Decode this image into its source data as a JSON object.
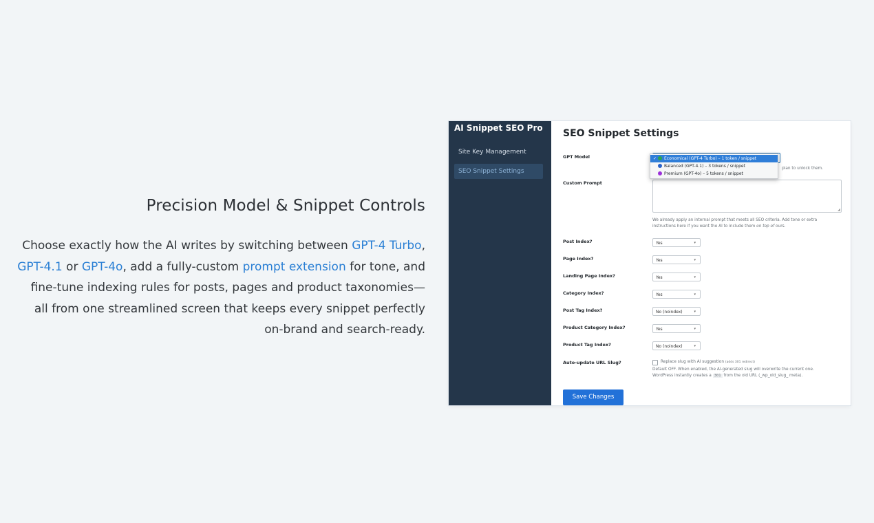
{
  "marketing": {
    "title": "Precision Model & Snippet Controls",
    "p1": "Choose exactly how the AI writes by switching between ",
    "model1": "GPT-4 Turbo",
    "p2": ",",
    "model2": "GPT-4.1",
    "p3": " or ",
    "model3": "GPT-4o",
    "p4": ", add a fully-custom ",
    "prompt_ext": "prompt extension",
    "p5": " for tone, and fine-tune indexing rules for posts, pages and product taxonomies— all from one streamlined screen that keeps every snippet perfectly on-brand and search-ready."
  },
  "sidebar": {
    "brand": "AI Snippet SEO Pro",
    "items": [
      {
        "label": "Site Key Management"
      },
      {
        "label": "SEO Snippet Settings"
      }
    ]
  },
  "settings": {
    "title": "SEO Snippet Settings",
    "gpt_model_label": "GPT Model",
    "gpt_options": [
      {
        "label": "Economical (GPT-4 Turbo) – 1 token / snippet",
        "color": "#2ea44f",
        "selected": true
      },
      {
        "label": "Balanced (GPT-4.1) – 3 tokens / snippet",
        "color": "#2a63c9",
        "selected": false
      },
      {
        "label": "Premium (GPT-4o) – 5 tokens / snippet",
        "color": "#9b30d9",
        "selected": false
      }
    ],
    "gpt_help_tail": "plan to unlock them.",
    "custom_prompt_label": "Custom Prompt",
    "custom_prompt_value": "",
    "custom_prompt_help_a": "We already apply an internal prompt that meets all SEO criteria. Add tone or extra",
    "custom_prompt_help_b": "instructions here if you want the AI to include them ",
    "custom_prompt_help_em": "on top of",
    "custom_prompt_help_c": " ours.",
    "fields": [
      {
        "label": "Post Index?",
        "value": "Yes"
      },
      {
        "label": "Page Index?",
        "value": "Yes"
      },
      {
        "label": "Landing Page Index?",
        "value": "Yes"
      },
      {
        "label": "Category Index?",
        "value": "Yes"
      },
      {
        "label": "Post Tag Index?",
        "value": "No (noindex)"
      },
      {
        "label": "Product Category Index?",
        "value": "Yes"
      },
      {
        "label": "Product Tag Index?",
        "value": "No (noindex)"
      }
    ],
    "slug_label": "Auto-update URL Slug?",
    "slug_checkbox_label": "Replace slug with AI suggestion",
    "slug_checkbox_note": "(adds 301 redirect)",
    "slug_help_1": "Default OFF. When enabled, the AI-generated slug will overwrite the current one.",
    "slug_help_2a": "WordPress instantly creates a ",
    "slug_help_code": "301",
    "slug_help_2b": " from the old URL (_wp_old_slug_ meta).",
    "save_label": "Save Changes"
  }
}
